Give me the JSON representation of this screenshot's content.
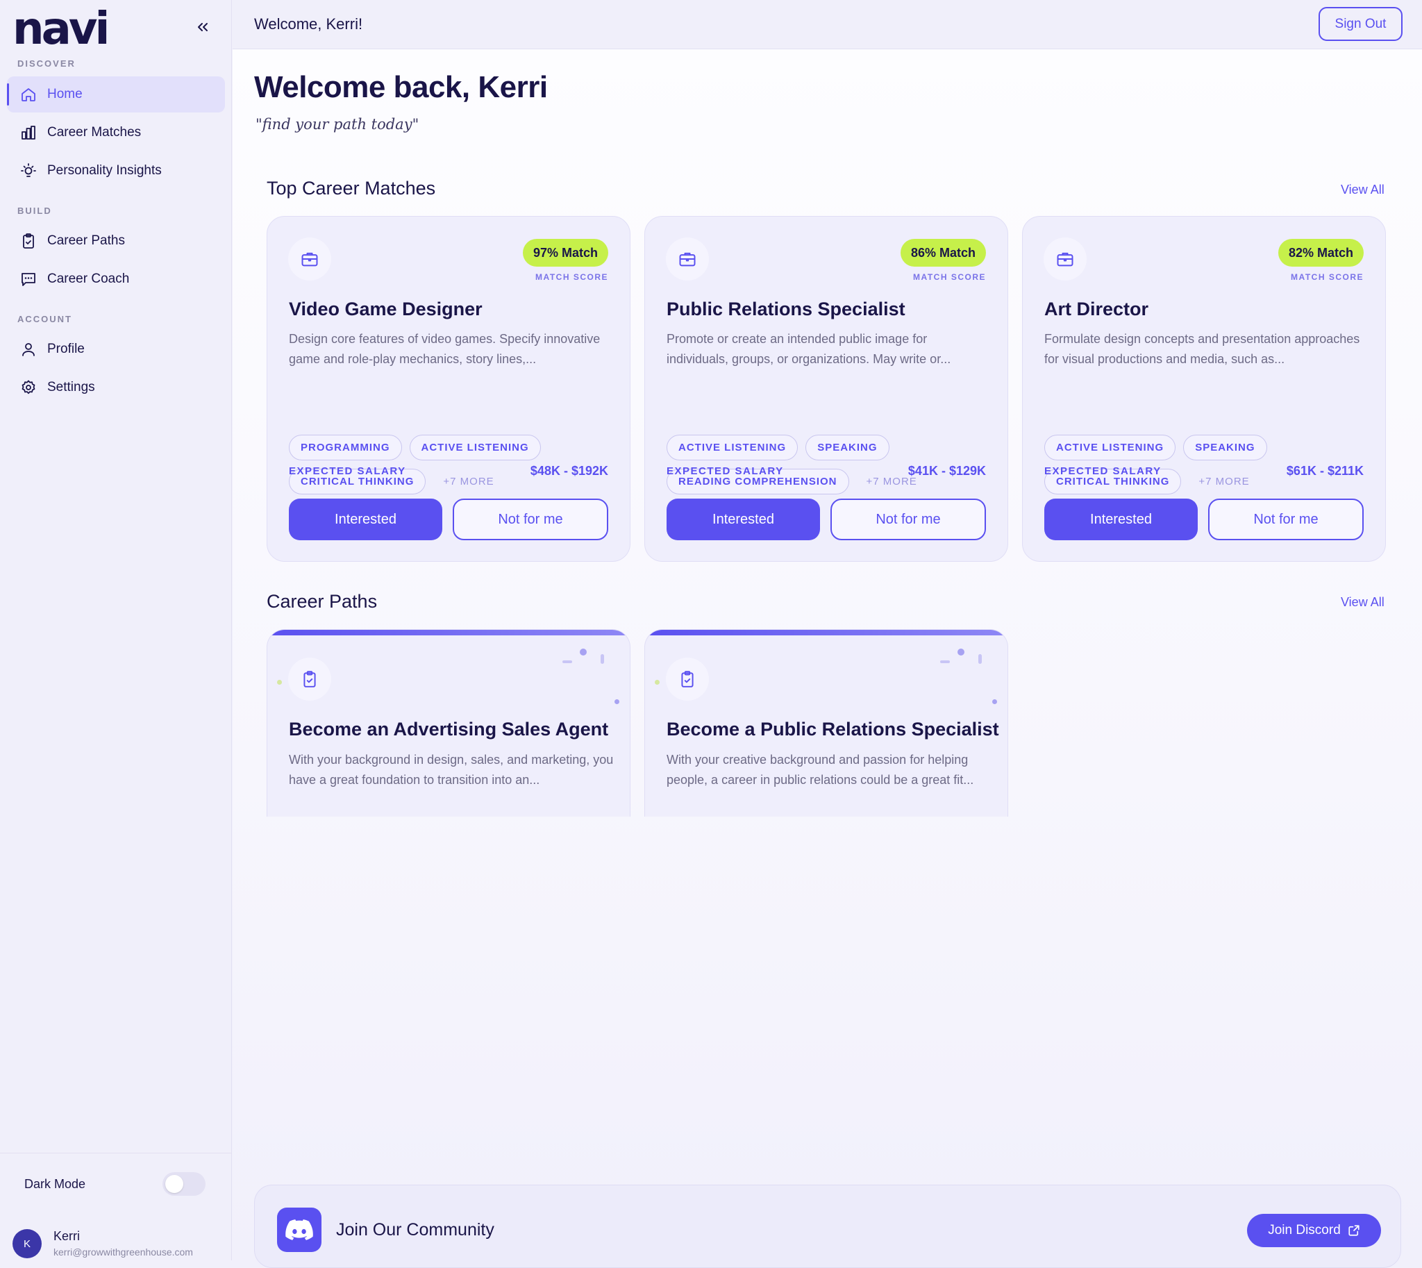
{
  "app": {
    "logo": "navi"
  },
  "sidebar": {
    "sections": {
      "discover": "DISCOVER",
      "build": "BUILD",
      "account": "ACCOUNT"
    },
    "items": [
      {
        "label": "Home",
        "icon": "home-icon",
        "active": true
      },
      {
        "label": "Career Matches",
        "icon": "bar-chart-icon"
      },
      {
        "label": "Personality Insights",
        "icon": "lightbulb-icon"
      },
      {
        "label": "Career Paths",
        "icon": "clipboard-check-icon"
      },
      {
        "label": "Career Coach",
        "icon": "chat-icon"
      },
      {
        "label": "Profile",
        "icon": "user-icon"
      },
      {
        "label": "Settings",
        "icon": "gear-icon"
      }
    ],
    "dark_mode_label": "Dark Mode",
    "dark_mode_on": false,
    "user": {
      "initial": "K",
      "name": "Kerri",
      "email": "kerri@growwithgreenhouse.com"
    }
  },
  "header": {
    "welcome": "Welcome, Kerri!",
    "sign_out": "Sign Out"
  },
  "main": {
    "title": "Welcome back, Kerri",
    "tagline": "\"find your path today\"",
    "matches_title": "Top Career Matches",
    "paths_title": "Career Paths",
    "view_all": "View All",
    "match_score_label": "MATCH SCORE",
    "salary_label": "EXPECTED SALARY",
    "interested": "Interested",
    "not_for_me": "Not for me",
    "cards": [
      {
        "match": "97% Match",
        "title": "Video Game Designer",
        "desc": "Design core features of video games. Specify innovative game and role-play mechanics, story lines,...",
        "chips": [
          "PROGRAMMING",
          "ACTIVE LISTENING",
          "CRITICAL THINKING"
        ],
        "more": "+7 MORE",
        "salary": "$48K - $192K"
      },
      {
        "match": "86% Match",
        "title": "Public Relations Specialist",
        "desc": "Promote or create an intended public image for individuals, groups, or organizations. May write or...",
        "chips": [
          "ACTIVE LISTENING",
          "SPEAKING",
          "READING COMPREHENSION"
        ],
        "more": "+7 MORE",
        "salary": "$41K - $129K"
      },
      {
        "match": "82% Match",
        "title": "Art Director",
        "desc": "Formulate design concepts and presentation approaches for visual productions and media, such as...",
        "chips": [
          "ACTIVE LISTENING",
          "SPEAKING",
          "CRITICAL THINKING"
        ],
        "more": "+7 MORE",
        "salary": "$61K - $211K"
      }
    ],
    "paths": [
      {
        "title": "Become an Advertising Sales Agent",
        "desc": "With your background in design, sales, and marketing, you have a great foundation to transition into an..."
      },
      {
        "title": "Become a Public Relations Specialist",
        "desc": "With your creative background and passion for helping people, a career in public relations could be a great fit..."
      }
    ],
    "community": {
      "title": "Join Our Community",
      "button": "Join Discord"
    }
  },
  "colors": {
    "accent": "#5a50f0",
    "match_badge": "#c6f04a",
    "text": "#1a1548"
  }
}
